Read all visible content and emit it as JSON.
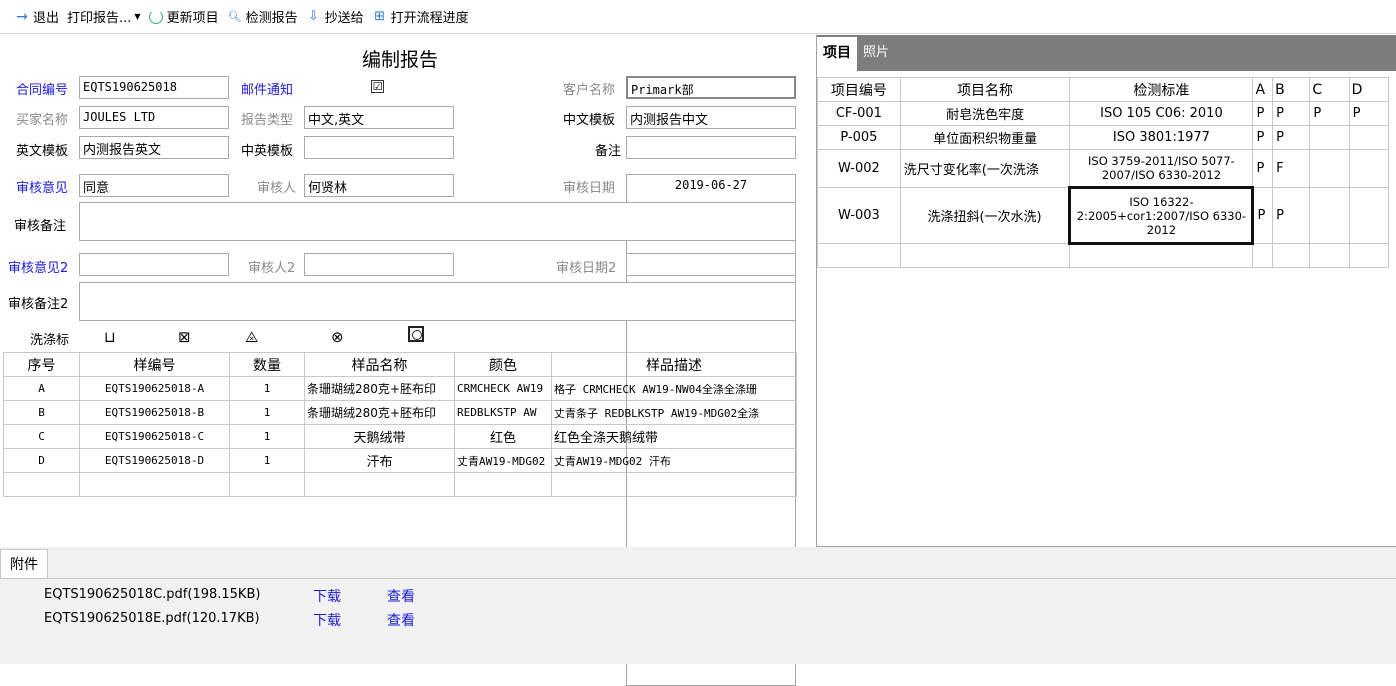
{
  "toolbar": {
    "exit": "退出",
    "print": "打印报告...",
    "update": "更新项目",
    "report": "检测报告",
    "cc": "抄送给",
    "flow": "打开流程进度"
  },
  "form": {
    "title": "编制报告",
    "contract_label": "合同编号",
    "contract_value": "EQTS190625018",
    "mail_label": "邮件通知",
    "mail_checked": "☑",
    "customer_label": "客户名称",
    "customer_value": "Primark部",
    "buyer_label": "买家名称",
    "buyer_value": "JOULES LTD",
    "report_type_label": "报告类型",
    "report_type_value": "中文,英文",
    "cn_template_label": "中文模板",
    "cn_template_value": "内测报告中文",
    "en_template_label": "英文模板",
    "en_template_value": "内测报告英文",
    "cn_en_template_label": "中英模板",
    "cn_en_template_value": "",
    "remark_label": "备注",
    "remark_value": "",
    "review_label": "审核意见",
    "review_value": "同意",
    "reviewer_label": "审核人",
    "reviewer_value": "何贤林",
    "review_date_label": "审核日期",
    "review_date_value": "2019-06-27",
    "review_note_label": "审核备注",
    "review2_label": "审核意见2",
    "reviewer2_label": "审核人2",
    "review_date2_label": "审核日期2",
    "review_note2_label": "审核备注2",
    "wash_label": "洗涤标"
  },
  "samples": {
    "headers": [
      "序号",
      "样编号",
      "数量",
      "样品名称",
      "颜色",
      "样品描述"
    ],
    "rows": [
      [
        "A",
        "EQTS190625018-A",
        "1",
        "条珊瑚绒280克+胚布印",
        "CRMCHECK AW19",
        "格子 CRMCHECK AW19-NW04全涤全涤珊"
      ],
      [
        "B",
        "EQTS190625018-B",
        "1",
        "条珊瑚绒280克+胚布印",
        "REDBLKSTP AW",
        "丈青条子 REDBLKSTP AW19-MDG02全涤"
      ],
      [
        "C",
        "EQTS190625018-C",
        "1",
        "天鹅绒带",
        "红色",
        "红色全涤天鹅绒带"
      ],
      [
        "D",
        "EQTS190625018-D",
        "1",
        "汗布",
        "丈青AW19-MDG02",
        "丈青AW19-MDG02 汗布"
      ]
    ]
  },
  "right": {
    "tab_items": "项目",
    "tab_photos": "照片",
    "headers": [
      "项目编号",
      "项目名称",
      "检测标准",
      "A",
      "B",
      "C",
      "D"
    ],
    "rows": [
      [
        "CF-001",
        "耐皂洗色牢度",
        "ISO 105 C06: 2010",
        "P",
        "P",
        "P",
        "P"
      ],
      [
        "P-005",
        "单位面积织物重量",
        "ISO 3801:1977",
        "P",
        "P",
        "",
        ""
      ],
      [
        "W-002",
        "洗尺寸变化率(一次洗涤",
        "ISO 3759-2011/ISO 5077-2007/ISO 6330-2012",
        "P",
        "F",
        "",
        ""
      ],
      [
        "W-003",
        "洗涤扭斜(一次水洗)",
        "ISO 16322-2:2005+cor1:2007/ISO 6330-2012",
        "P",
        "P",
        "",
        ""
      ]
    ]
  },
  "attachments": {
    "tab": "附件",
    "files": [
      {
        "name": "EQTS190625018C.pdf(198.15KB)",
        "download": "下载",
        "view": "查看"
      },
      {
        "name": "EQTS190625018E.pdf(120.17KB)",
        "download": "下载",
        "view": "查看"
      }
    ]
  }
}
